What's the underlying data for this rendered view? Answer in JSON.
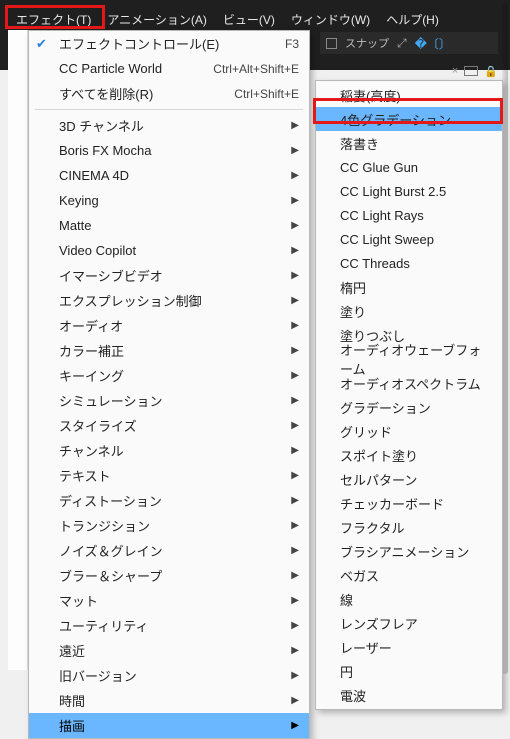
{
  "menubar": {
    "items": [
      {
        "label": "エフェクト(T)"
      },
      {
        "label": "アニメーション(A)"
      },
      {
        "label": "ビュー(V)"
      },
      {
        "label": "ウィンドウ(W)"
      },
      {
        "label": "ヘルプ(H)"
      }
    ]
  },
  "toolbar": {
    "snap": "スナップ"
  },
  "dropdown": {
    "top": [
      {
        "label": "エフェクトコントロール(E)",
        "shortcut": "F3",
        "checked": true
      },
      {
        "label": "CC Particle World",
        "shortcut": "Ctrl+Alt+Shift+E"
      },
      {
        "label": "すべてを削除(R)",
        "shortcut": "Ctrl+Shift+E"
      }
    ],
    "categories": [
      {
        "label": "3D チャンネル"
      },
      {
        "label": "Boris FX Mocha"
      },
      {
        "label": "CINEMA 4D"
      },
      {
        "label": "Keying"
      },
      {
        "label": "Matte"
      },
      {
        "label": "Video Copilot"
      },
      {
        "label": "イマーシブビデオ"
      },
      {
        "label": "エクスプレッション制御"
      },
      {
        "label": "オーディオ"
      },
      {
        "label": "カラー補正"
      },
      {
        "label": "キーイング"
      },
      {
        "label": "シミュレーション"
      },
      {
        "label": "スタイライズ"
      },
      {
        "label": "チャンネル"
      },
      {
        "label": "テキスト"
      },
      {
        "label": "ディストーション"
      },
      {
        "label": "トランジション"
      },
      {
        "label": "ノイズ＆グレイン"
      },
      {
        "label": "ブラー＆シャープ"
      },
      {
        "label": "マット"
      },
      {
        "label": "ユーティリティ"
      },
      {
        "label": "遠近"
      },
      {
        "label": "旧バージョン"
      },
      {
        "label": "時間"
      },
      {
        "label": "描画",
        "hover": true
      }
    ]
  },
  "submenu": {
    "items": [
      {
        "label": "稲妻(高度)"
      },
      {
        "label": "4色グラデーション",
        "hover": true
      },
      {
        "label": "落書き"
      },
      {
        "label": "CC Glue Gun"
      },
      {
        "label": "CC Light Burst 2.5"
      },
      {
        "label": "CC Light Rays"
      },
      {
        "label": "CC Light Sweep"
      },
      {
        "label": "CC Threads"
      },
      {
        "label": "楕円"
      },
      {
        "label": "塗り"
      },
      {
        "label": "塗りつぶし"
      },
      {
        "label": "オーディオウェーブフォーム"
      },
      {
        "label": "オーディオスペクトラム"
      },
      {
        "label": "グラデーション"
      },
      {
        "label": "グリッド"
      },
      {
        "label": "スポイト塗り"
      },
      {
        "label": "セルパターン"
      },
      {
        "label": "チェッカーボード"
      },
      {
        "label": "フラクタル"
      },
      {
        "label": "ブラシアニメーション"
      },
      {
        "label": "ベガス"
      },
      {
        "label": "線"
      },
      {
        "label": "レンズフレア"
      },
      {
        "label": "レーザー"
      },
      {
        "label": "円"
      },
      {
        "label": "電波"
      }
    ]
  }
}
